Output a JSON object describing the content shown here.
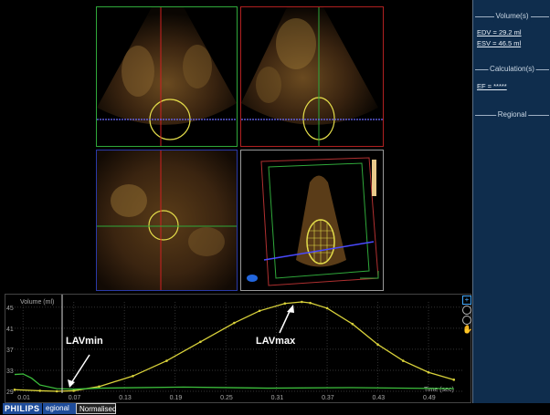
{
  "sidebar": {
    "volumes_header": "Volume(s)",
    "edv": "EDV = 29.2 ml",
    "esv": "ESV = 46.5 ml",
    "calculations_header": "Calculation(s)",
    "ef": "EF = *****",
    "regional_header": "Regional"
  },
  "graph": {
    "y_axis_label": "Volume (ml)",
    "x_axis_label": "Time (sec)",
    "annotation_min": "LAVmin",
    "annotation_max": "LAVmax",
    "y_ticks": [
      "45",
      "41",
      "37",
      "33",
      "29"
    ],
    "x_ticks": [
      "0.01",
      "0.07",
      "0.13",
      "0.19",
      "0.25",
      "0.31",
      "0.37",
      "0.43",
      "0.49"
    ]
  },
  "chart_data": {
    "type": "line",
    "ylabel": "Volume (ml)",
    "xlabel": "Time (sec)",
    "ylim": [
      29,
      46
    ],
    "xlim": [
      0.0,
      0.53
    ],
    "series": [
      {
        "color": "#d9d23a",
        "x": [
          0.0,
          0.03,
          0.05,
          0.07,
          0.1,
          0.14,
          0.18,
          0.22,
          0.26,
          0.29,
          0.32,
          0.34,
          0.35,
          0.37,
          0.4,
          0.43,
          0.46,
          0.49,
          0.52
        ],
        "y": [
          29.3,
          29.1,
          29.0,
          29.1,
          29.9,
          31.9,
          34.8,
          38.4,
          42.0,
          44.3,
          45.7,
          46.0,
          45.8,
          44.8,
          41.8,
          37.9,
          34.8,
          32.6,
          31.2
        ]
      },
      {
        "color": "#3cbf3c",
        "x": [
          0.0,
          0.01,
          0.02,
          0.03,
          0.05,
          0.07,
          0.1,
          0.2,
          0.3,
          0.4,
          0.52
        ],
        "y": [
          32.2,
          32.3,
          31.5,
          30.2,
          29.5,
          29.4,
          29.6,
          29.8,
          29.6,
          29.7,
          29.5
        ]
      }
    ]
  },
  "bottombar": {
    "brand": "PHILIPS",
    "tab_regional": "egional",
    "tab_normalised": "Normalised"
  },
  "icons": {
    "plus": "plus-icon",
    "zoom_in": "zoom-in-icon",
    "zoom_out": "zoom-out-icon",
    "hand": "hand-icon"
  },
  "colors": {
    "sidebar_bg": "#0f2d4d",
    "curve_yellow": "#d9d23a",
    "curve_green": "#3cbf3c",
    "brand_blue": "#1e4c9a"
  }
}
